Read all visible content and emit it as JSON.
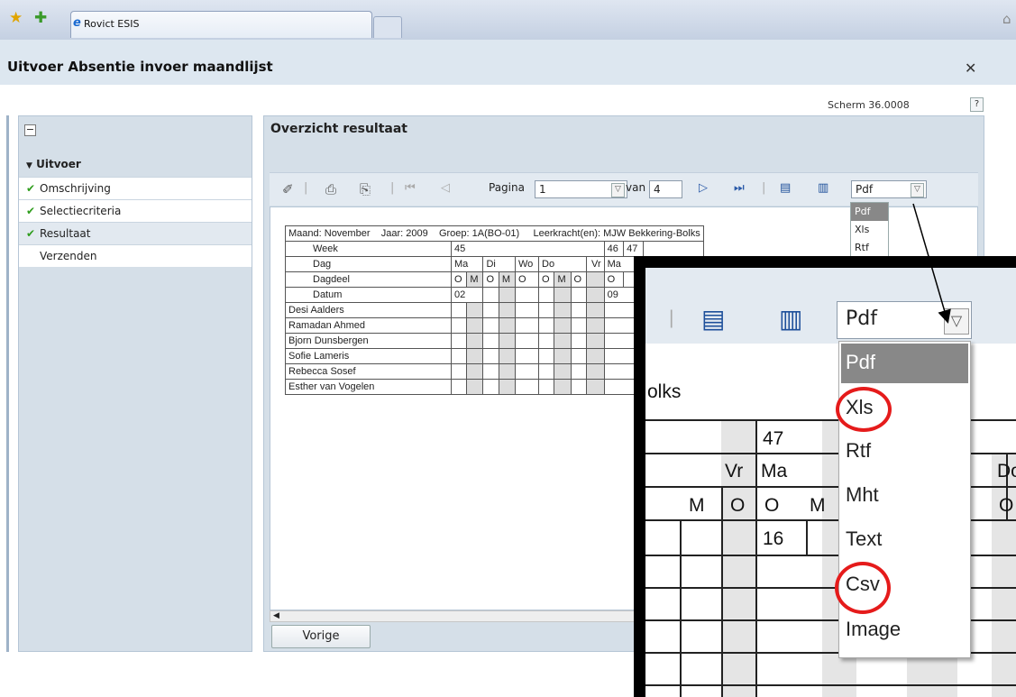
{
  "browser": {
    "tab_title": "Rovict ESIS"
  },
  "window": {
    "title": "Uitvoer Absentie invoer maandlijst",
    "screen_code": "Scherm 36.0008",
    "help_label": "?"
  },
  "sidebar": {
    "section_title": "Uitvoer",
    "items": [
      {
        "label": "Omschrijving",
        "done": true
      },
      {
        "label": "Selectiecriteria",
        "done": true
      },
      {
        "label": "Resultaat",
        "done": true,
        "active": true
      },
      {
        "label": "Verzenden",
        "done": false
      }
    ]
  },
  "main": {
    "title": "Overzicht resultaat",
    "toolbar": {
      "page_label": "Pagina",
      "page_value": "1",
      "of_label": "van",
      "of_value": "4",
      "format_value": "Pdf"
    },
    "format_options": [
      "Pdf",
      "Xls",
      "Rtf",
      "Mht",
      "Text",
      "Csv",
      "Image"
    ],
    "back_button": "Vorige"
  },
  "report": {
    "header": {
      "maand": "Maand: November",
      "jaar": "Jaar: 2009",
      "groep": "Groep: 1A(BO-01)",
      "leerkracht": "Leerkracht(en): MJW Bekkering-Bolks"
    },
    "row_labels": {
      "week": "Week",
      "dag": "Dag",
      "dagdeel": "Dagdeel",
      "datum": "Datum"
    },
    "weeks": [
      "45",
      "46",
      "47"
    ],
    "days": [
      "Ma",
      "Di",
      "Wo",
      "Do",
      "Vr",
      "Ma"
    ],
    "dagdelen": [
      "O",
      "M",
      "O",
      "M",
      "O",
      "O",
      "M",
      "O",
      "O"
    ],
    "dates": [
      "02",
      "09"
    ],
    "students": [
      "Desi Aalders",
      "Ramadan Ahmed",
      "Bjorn Dunsbergen",
      "Sofie Lameris",
      "Rebecca Sosef",
      "Esther van Vogelen"
    ]
  },
  "zoom": {
    "header_fragment": "olks",
    "week": "47",
    "days": [
      "Vr",
      "Ma",
      "Do"
    ],
    "dagdelen": [
      "M",
      "O",
      "O",
      "M",
      "O"
    ],
    "date": "16",
    "format_value": "Pdf",
    "highlighted_options": [
      "Xls",
      "Csv"
    ]
  },
  "colors": {
    "highlight_circle": "#e51b1b",
    "selected_option": "#888888",
    "check": "#2f9d1d"
  }
}
